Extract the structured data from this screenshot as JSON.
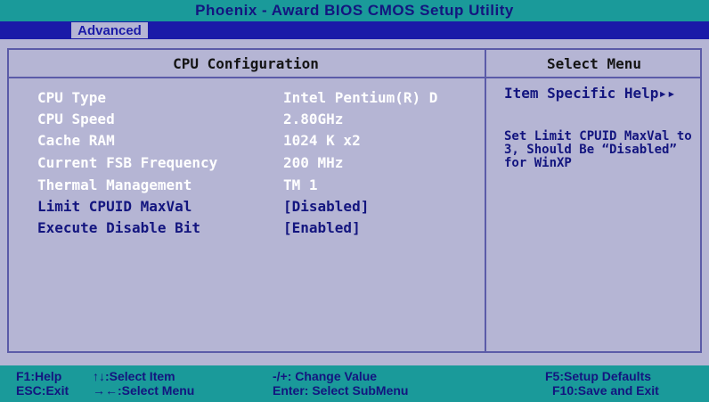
{
  "title": "Phoenix - Award BIOS CMOS Setup Utility",
  "menu": {
    "active_tab": "Advanced"
  },
  "left_panel": {
    "header": "CPU Configuration",
    "rows": [
      {
        "label": "CPU Type",
        "value": "Intel Pentium(R) D",
        "kind": "info"
      },
      {
        "label": "CPU Speed",
        "value": "2.80GHz",
        "kind": "info"
      },
      {
        "label": "Cache RAM",
        "value": "1024 K x2",
        "kind": "info"
      },
      {
        "label": "Current FSB Frequency",
        "value": "200 MHz",
        "kind": "info"
      },
      {
        "label": "Thermal Management",
        "value": "TM 1",
        "kind": "info"
      },
      {
        "label": "Limit CPUID MaxVal",
        "value": "[Disabled]",
        "kind": "setting"
      },
      {
        "label": "Execute Disable Bit",
        "value": "[Enabled]",
        "kind": "setting"
      }
    ]
  },
  "right_panel": {
    "header": "Select Menu",
    "help_title": "Item Specific Help▸▸",
    "help_text": "Set Limit CPUID MaxVal to 3, Should Be “Disabled” for WinXP"
  },
  "footer": {
    "f1": "F1:Help",
    "esc": "ESC:Exit",
    "select_item": "↑↓:Select Item",
    "select_menu": "→←:Select Menu",
    "change_value": "-/+: Change Value",
    "enter": "Enter: Select SubMenu",
    "f5": "F5:Setup Defaults",
    "f10": "F10:Save and Exit"
  },
  "colors": {
    "title_bar": "#1a9a9a",
    "menu_bar": "#1a1aa8",
    "panel_bg": "#b5b5d4",
    "text_dark_blue": "#13157f",
    "text_white": "#ffffff"
  }
}
